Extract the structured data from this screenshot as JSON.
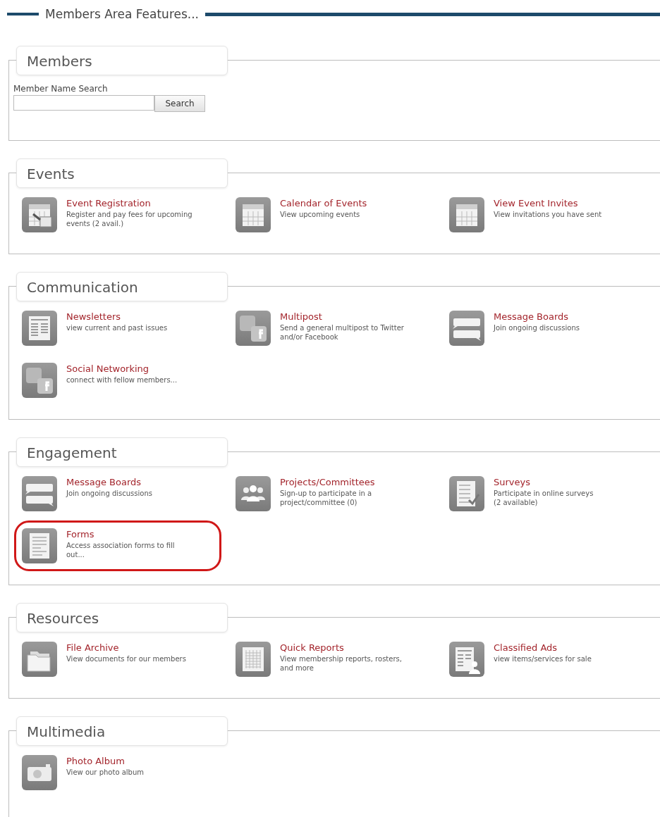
{
  "heading": "Members Area Features...",
  "sections": [
    {
      "title": "Members",
      "kind": "search",
      "search": {
        "label": "Member Name Search",
        "button": "Search"
      }
    },
    {
      "title": "Events",
      "kind": "features",
      "items": [
        {
          "kind": "calendar-edit",
          "title": "Event Registration",
          "description": "Register and pay fees for upcoming\nevents (2 avail.)",
          "highlighted": false
        },
        {
          "kind": "calendar",
          "title": "Calendar of Events",
          "description": "View upcoming events",
          "highlighted": false
        },
        {
          "kind": "calendar",
          "title": "View Event Invites",
          "description": "View invitations you have sent",
          "highlighted": false
        }
      ]
    },
    {
      "title": "Communication",
      "kind": "features",
      "items": [
        {
          "kind": "newsletter",
          "title": "Newsletters",
          "description": "view current and past issues",
          "highlighted": false
        },
        {
          "kind": "social",
          "title": "Multipost",
          "description": "Send a general multipost to Twitter\nand/or Facebook",
          "highlighted": false
        },
        {
          "kind": "bubbles",
          "title": "Message Boards",
          "description": "Join ongoing discussions",
          "highlighted": false
        },
        {
          "kind": "social",
          "title": "Social Networking",
          "description": "connect with fellow members...",
          "highlighted": false
        }
      ]
    },
    {
      "title": "Engagement",
      "kind": "features",
      "items": [
        {
          "kind": "bubbles",
          "title": "Message Boards",
          "description": "Join ongoing discussions",
          "highlighted": false
        },
        {
          "kind": "people",
          "title": "Projects/Committees",
          "description": "Sign-up to participate in a\nproject/committee (0)",
          "highlighted": false
        },
        {
          "kind": "checklist",
          "title": "Surveys",
          "description": "Participate in online surveys\n(2 available)",
          "highlighted": false
        },
        {
          "kind": "form",
          "title": "Forms",
          "description": "Access association forms to fill\nout...",
          "highlighted": true
        }
      ]
    },
    {
      "title": "Resources",
      "kind": "features",
      "items": [
        {
          "kind": "folder",
          "title": "File Archive",
          "description": "View documents for our members",
          "highlighted": false
        },
        {
          "kind": "grid",
          "title": "Quick Reports",
          "description": "View membership reports, rosters,\nand more",
          "highlighted": false
        },
        {
          "kind": "classified",
          "title": "Classified Ads",
          "description": "view items/services for sale",
          "highlighted": false
        }
      ]
    },
    {
      "title": "Multimedia",
      "kind": "features",
      "items": [
        {
          "kind": "camera",
          "title": "Photo Album",
          "description": "View our photo album",
          "highlighted": false
        }
      ]
    }
  ]
}
